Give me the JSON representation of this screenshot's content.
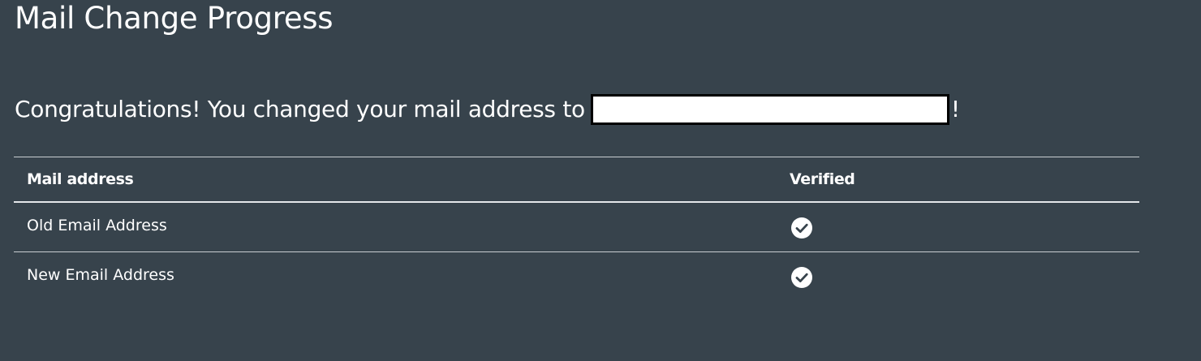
{
  "page": {
    "title": "Mail Change Progress",
    "congrats_prefix": "Congratulations! You changed your mail address to",
    "congrats_suffix": "!"
  },
  "table": {
    "headers": [
      "Mail address",
      "Verified"
    ],
    "rows": [
      {
        "label": "Old Email Address",
        "verified_icon": "check-circle-icon"
      },
      {
        "label": "New Email Address",
        "verified_icon": "check-circle-icon"
      }
    ]
  },
  "colors": {
    "background": "#37434c",
    "text": "#ffffff",
    "divider": "#c9ced2"
  }
}
